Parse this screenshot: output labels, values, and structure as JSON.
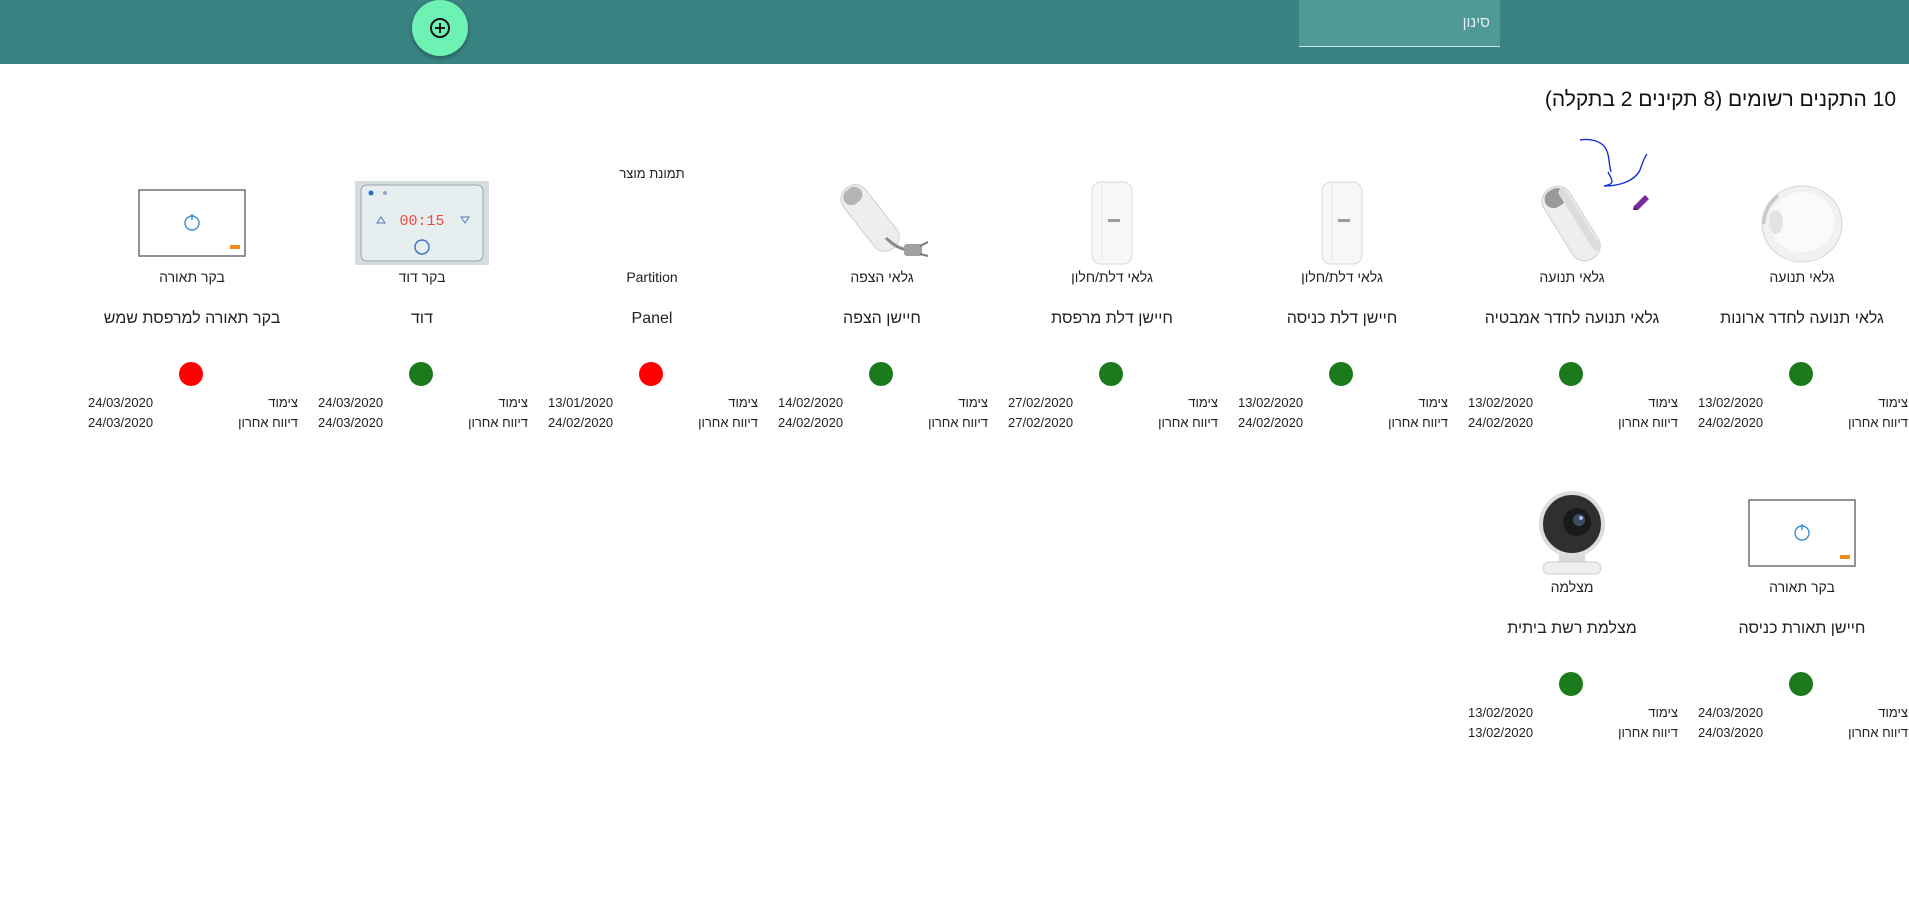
{
  "header": {
    "filter_placeholder": "סינון",
    "add_button_icon": "add-circle-icon",
    "background_color": "#3a8383",
    "fab_color": "#6ef2b3"
  },
  "summary": "10 התקנים רשומים (8 תקינים 2 בתקלה)",
  "status_colors": {
    "ok": "#1b7a1b",
    "fault": "#ff0000"
  },
  "labels": {
    "paired": "צימוד",
    "last_report": "דיווח אחרון"
  },
  "broken_image_alt": "תמונת מוצר",
  "devices": [
    {
      "type": "גלאי תנועה",
      "name": "גלאי תנועה לחדר ארונות",
      "status": "ok",
      "paired": "13/02/2020",
      "last_report": "24/02/2020",
      "image": "motion-sensor-round"
    },
    {
      "type": "גלאי תנועה",
      "name": "גלאי תנועה לחדר אמבטיה",
      "status": "ok",
      "paired": "13/02/2020",
      "last_report": "24/02/2020",
      "image": "motion-sensor-pir"
    },
    {
      "type": "גלאי דלת/חלון",
      "name": "חיישן דלת כניסה",
      "status": "ok",
      "paired": "13/02/2020",
      "last_report": "24/02/2020",
      "image": "door-sensor"
    },
    {
      "type": "גלאי דלת/חלון",
      "name": "חיישן דלת מרפסת",
      "status": "ok",
      "paired": "27/02/2020",
      "last_report": "27/02/2020",
      "image": "door-sensor"
    },
    {
      "type": "גלאי הצפה",
      "name": "חיישן הצפה",
      "status": "ok",
      "paired": "14/02/2020",
      "last_report": "24/02/2020",
      "image": "flood-sensor"
    },
    {
      "type": "Partition",
      "name": "Panel",
      "status": "fault",
      "paired": "13/01/2020",
      "last_report": "24/02/2020",
      "image": "broken"
    },
    {
      "type": "בקר דוד",
      "name": "דוד",
      "status": "ok",
      "paired": "24/03/2020",
      "last_report": "24/03/2020",
      "image": "boiler-controller",
      "display": "00:15"
    },
    {
      "type": "בקר תאורה",
      "name": "בקר תאורה למרפסת שמש",
      "status": "fault",
      "paired": "24/03/2020",
      "last_report": "24/03/2020",
      "image": "light-switch"
    },
    {
      "type": "בקר תאורה",
      "name": "חיישן תאורת כניסה",
      "status": "ok",
      "paired": "24/03/2020",
      "last_report": "24/03/2020",
      "image": "light-switch"
    },
    {
      "type": "מצלמה",
      "name": "מצלמת רשת ביתית",
      "status": "ok",
      "paired": "13/02/2020",
      "last_report": "13/02/2020",
      "image": "camera"
    }
  ]
}
